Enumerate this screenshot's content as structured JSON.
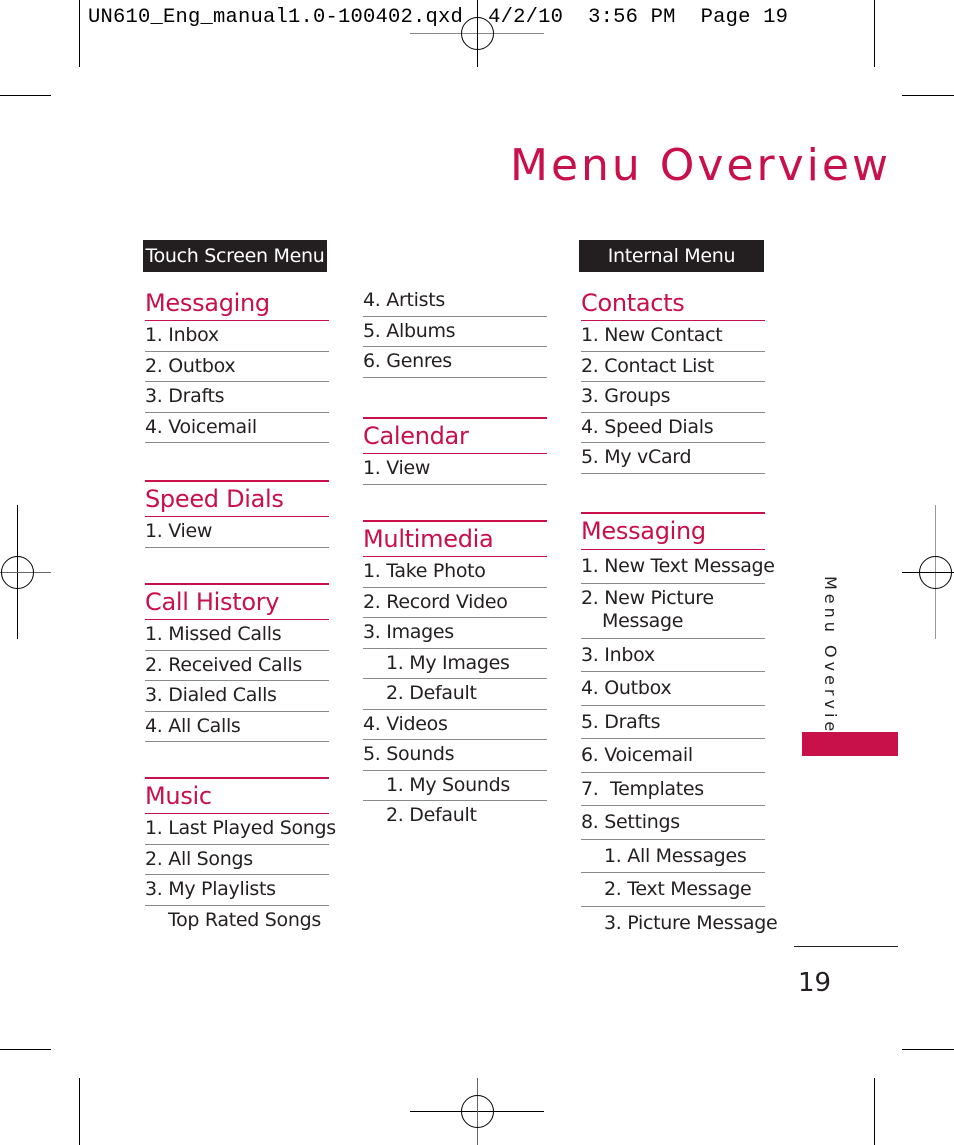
{
  "slug": "UN610_Eng_manual1.0-100402.qxd  4/2/10  3:56 PM  Page 19",
  "title": "Menu Overview",
  "side_label": "Menu Overview",
  "page_number": "19",
  "accent_color": "#c8104a",
  "bars": {
    "touch": "Touch Screen Menu",
    "internal": "Internal Menu"
  },
  "col1": {
    "messaging": {
      "title": "Messaging",
      "items": [
        "1. Inbox",
        "2. Outbox",
        "3. Drafts",
        "4. Voicemail"
      ]
    },
    "speed_dials": {
      "title": "Speed Dials",
      "items": [
        "1. View"
      ]
    },
    "call_history": {
      "title": "Call History",
      "items": [
        "1. Missed Calls",
        "2. Received Calls",
        "3. Dialed Calls",
        "4. All Calls"
      ]
    },
    "music": {
      "title": "Music",
      "items": [
        "1. Last Played Songs",
        "2. All Songs",
        "3. My Playlists"
      ],
      "sub_items": [
        "Top Rated Songs"
      ]
    }
  },
  "col2": {
    "music_cont": {
      "items": [
        "4. Artists",
        "5. Albums",
        "6. Genres"
      ]
    },
    "calendar": {
      "title": "Calendar",
      "items": [
        "1. View"
      ]
    },
    "multimedia": {
      "title": "Multimedia",
      "items": [
        "1. Take Photo",
        "2. Record Video",
        "3. Images",
        "1. My Images",
        "2. Default",
        "4. Videos",
        "5. Sounds",
        "1. My Sounds",
        "2. Default"
      ]
    }
  },
  "col3": {
    "contacts": {
      "title": "Contacts",
      "items": [
        "1. New Contact",
        "2. Contact List",
        "3. Groups",
        "4. Speed Dials",
        "5. My vCard"
      ]
    },
    "messaging": {
      "title": "Messaging",
      "items": [
        "1. New Text Message",
        "2. New Picture",
        "Message",
        "3. Inbox",
        "4. Outbox",
        "5. Drafts",
        "6. Voicemail",
        "7.  Templates",
        "8. Settings",
        "1. All Messages",
        "2. Text Message",
        "3. Picture Message"
      ]
    }
  }
}
